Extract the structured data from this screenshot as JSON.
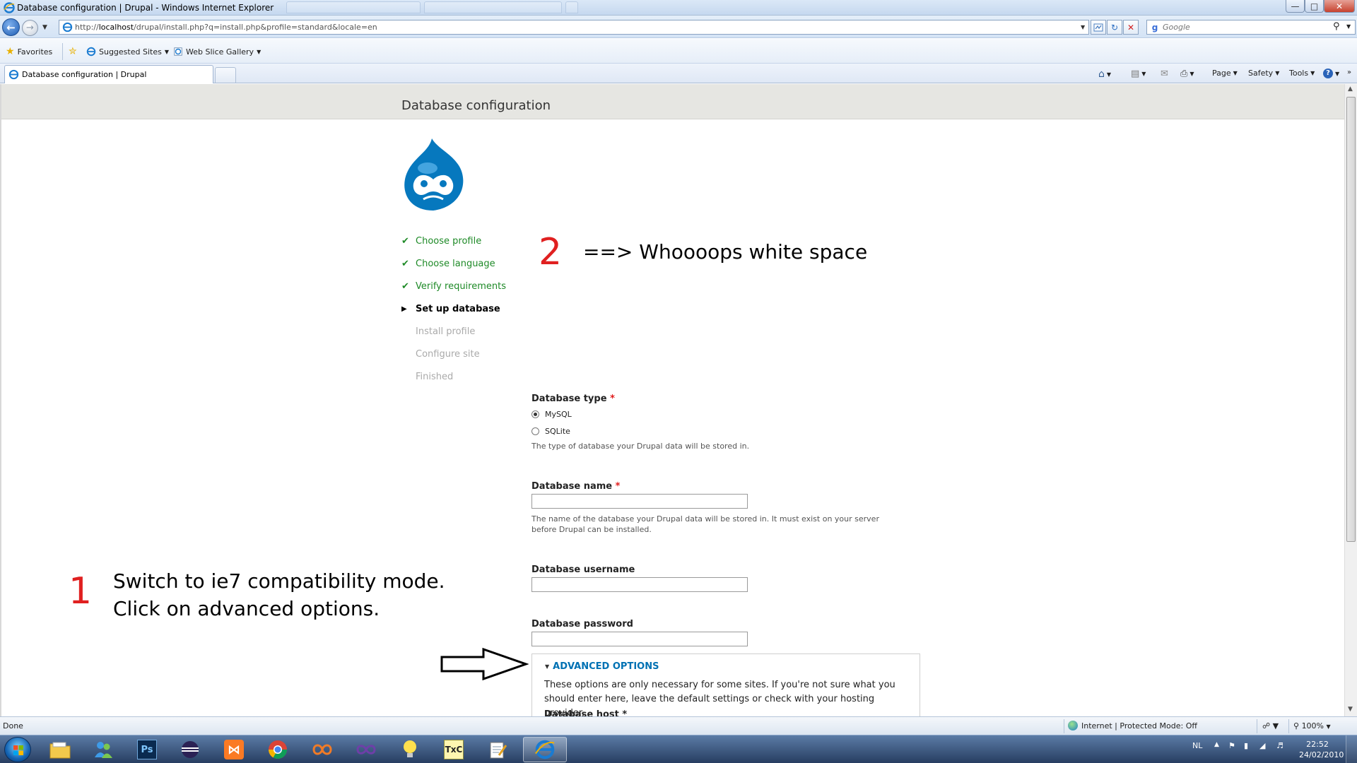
{
  "window": {
    "title": "Database configuration | Drupal - Windows Internet Explorer"
  },
  "address_bar": {
    "url_prefix": "http://",
    "url_host": "localhost",
    "url_path": "/drupal/install.php?q=install.php&profile=standard&locale=en"
  },
  "search": {
    "placeholder": "Google"
  },
  "favorites_bar": {
    "favorites_label": "Favorites",
    "suggested_sites_label": "Suggested Sites",
    "web_slice_gallery_label": "Web Slice Gallery"
  },
  "tab": {
    "label": "Database configuration | Drupal"
  },
  "command_bar": {
    "page_label": "Page",
    "safety_label": "Safety",
    "tools_label": "Tools"
  },
  "page": {
    "header_title": "Database configuration",
    "steps": [
      {
        "label": "Choose profile",
        "state": "done"
      },
      {
        "label": "Choose language",
        "state": "done"
      },
      {
        "label": "Verify requirements",
        "state": "done"
      },
      {
        "label": "Set up database",
        "state": "active"
      },
      {
        "label": "Install profile",
        "state": "todo"
      },
      {
        "label": "Configure site",
        "state": "todo"
      },
      {
        "label": "Finished",
        "state": "todo"
      }
    ],
    "form": {
      "db_type_label": "Database type",
      "db_type_options": [
        "MySQL",
        "SQLite"
      ],
      "db_type_selected": "MySQL",
      "db_type_desc": "The type of database your Drupal data will be stored in.",
      "db_name_label": "Database name",
      "db_name_value": "",
      "db_name_desc": "The name of the database your Drupal data will be stored in. It must exist on your server before Drupal can be installed.",
      "db_user_label": "Database username",
      "db_user_value": "",
      "db_pass_label": "Database password",
      "db_pass_value": "",
      "required_mark": "*",
      "advanced_legend": "ADVANCED OPTIONS",
      "advanced_desc": "These options are only necessary for some sites. If you're not sure what you should enter here, leave the default settings or check with your hosting provider.",
      "db_host_label": "Database host"
    }
  },
  "annotations": {
    "note1_number": "1",
    "note1_line1": "Switch to ie7 compatibility mode.",
    "note1_line2": "Click on advanced options.",
    "note2_number": "2",
    "note2_text": "==> Whoooops white space"
  },
  "status_bar": {
    "status_text": "Done",
    "zone_text": "Internet | Protected Mode: Off",
    "zoom": "100%"
  },
  "taskbar": {
    "language": "NL",
    "time": "22:52",
    "date": "24/02/2010"
  },
  "colors": {
    "done_green": "#1e8a27",
    "link_blue": "#0071b3",
    "required_red": "#e01b1b",
    "annotation_red": "#e02020",
    "drupal_blue": "#0678be"
  }
}
